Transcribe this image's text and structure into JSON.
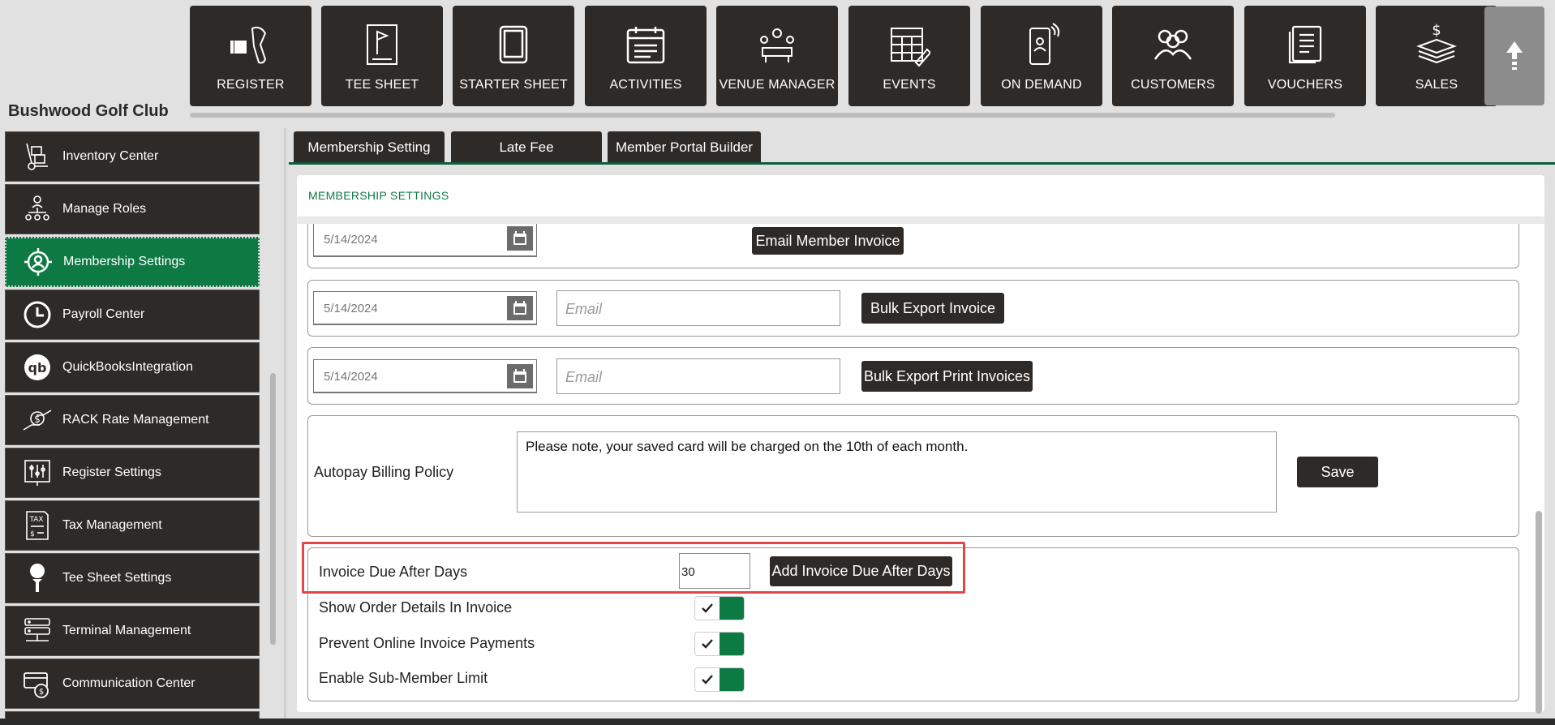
{
  "app": {
    "club_name": "Bushwood Golf Club"
  },
  "topnav": [
    {
      "label": "REGISTER",
      "icon": "barcode-scanner-icon"
    },
    {
      "label": "TEE SHEET",
      "icon": "flag-sheet-icon"
    },
    {
      "label": "STARTER SHEET",
      "icon": "tablet-icon"
    },
    {
      "label": "ACTIVITIES",
      "icon": "calendar-list-icon"
    },
    {
      "label": "VENUE MANAGER",
      "icon": "meeting-table-icon"
    },
    {
      "label": "EVENTS",
      "icon": "calendar-edit-icon"
    },
    {
      "label": "ON DEMAND",
      "icon": "phone-user-icon"
    },
    {
      "label": "CUSTOMERS",
      "icon": "people-icon"
    },
    {
      "label": "VOUCHERS",
      "icon": "voucher-icon"
    },
    {
      "label": "SALES",
      "icon": "money-stack-icon"
    }
  ],
  "sidebar": {
    "items": [
      {
        "label": "Inventory Center",
        "icon": "hand-truck-icon"
      },
      {
        "label": "Manage Roles",
        "icon": "org-chart-icon"
      },
      {
        "label": "Membership Settings",
        "icon": "gear-user-icon",
        "active": true
      },
      {
        "label": "Payroll Center",
        "icon": "clock-icon"
      },
      {
        "label": "QuickBooksIntegration",
        "icon": "quickbooks-icon"
      },
      {
        "label": "RACK Rate Management",
        "icon": "hand-dollar-icon"
      },
      {
        "label": "Register Settings",
        "icon": "sliders-icon"
      },
      {
        "label": "Tax Management",
        "icon": "tax-document-icon"
      },
      {
        "label": "Tee Sheet Settings",
        "icon": "golf-tee-icon"
      },
      {
        "label": "Terminal Management",
        "icon": "server-icon"
      },
      {
        "label": "Communication Center",
        "icon": "card-coin-icon"
      }
    ]
  },
  "tabs": [
    {
      "label": "Membership Setting"
    },
    {
      "label": "Late Fee"
    },
    {
      "label": "Member Portal Builder"
    }
  ],
  "panel": {
    "title": "MEMBERSHIP SETTINGS",
    "row1": {
      "date": "5/14/2024",
      "button": "Email Member Invoice"
    },
    "row2": {
      "date": "5/14/2024",
      "email_placeholder": "Email",
      "button": "Bulk Export Invoice"
    },
    "row3": {
      "date": "5/14/2024",
      "email_placeholder": "Email",
      "button": "Bulk Export Print Invoices"
    },
    "autopay": {
      "label": "Autopay Billing Policy",
      "text": "Please note, your saved card will be charged on the 10th of each month.",
      "save": "Save"
    },
    "invoice_due": {
      "label": "Invoice Due After Days",
      "value": "30",
      "button": "Add Invoice Due After Days"
    },
    "toggles": [
      {
        "label": "Show Order Details In Invoice",
        "checked": true
      },
      {
        "label": "Prevent Online Invoice Payments",
        "checked": true
      },
      {
        "label": "Enable Sub-Member Limit",
        "checked": true
      }
    ]
  },
  "colors": {
    "accent": "#0d7a43",
    "dark": "#2e2a27",
    "highlight": "#e04848"
  }
}
